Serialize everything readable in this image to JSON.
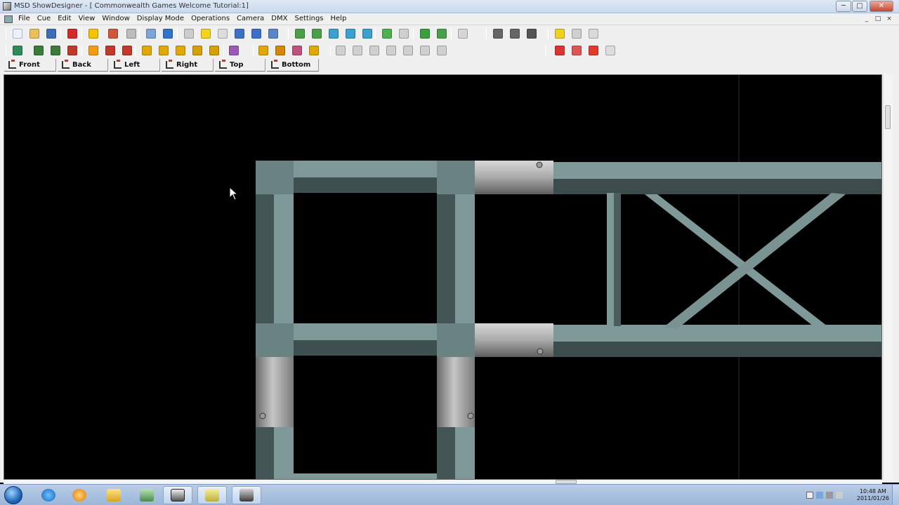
{
  "window": {
    "title": "MSD ShowDesigner - [ Commonwealth Games Welcome Tutorial:1]",
    "controls": {
      "minimize": "─",
      "maximize": "□",
      "close": "✕"
    },
    "mdi_controls": {
      "minimize": "_",
      "restore": "□",
      "close": "×"
    }
  },
  "menubar": {
    "items": [
      "File",
      "Cue",
      "Edit",
      "View",
      "Window",
      "Display Mode",
      "Operations",
      "Camera",
      "DMX",
      "Settings",
      "Help"
    ]
  },
  "toolbar": {
    "row1_icons": [
      "new-file",
      "open-folder",
      "save",
      "delete",
      "select-pointer",
      "undo",
      "redo",
      "print",
      "info",
      "cut",
      "light-bulb",
      "search",
      "fixture-f",
      "fixture-p",
      "fixture-key",
      "zoom-in",
      "zoom-check",
      "rotate",
      "move",
      "pan",
      "refresh",
      "refresh-disabled",
      "eye",
      "add-view",
      "disabled-box",
      "truss-a",
      "truss-b",
      "truss-c",
      "figure-light",
      "figure-gray",
      "figure-outline"
    ],
    "row2_icons": [
      "move-tool",
      "orbit",
      "orbit-b",
      "grid-tool",
      "snap",
      "arrow-h",
      "arrow-v",
      "fixture-y1",
      "fixture-y2",
      "fixture-y3",
      "link",
      "curve",
      "text-tool",
      "box-a",
      "box-b",
      "box-c",
      "box-d",
      "disabled-1",
      "disabled-2",
      "disabled-3",
      "disabled-4",
      "disabled-5",
      "disabled-6",
      "disabled-7",
      "render-wire",
      "render-solid",
      "render-red",
      "render-gray"
    ]
  },
  "views": {
    "buttons": [
      "Front",
      "Back",
      "Left",
      "Right",
      "Top",
      "Bottom"
    ]
  },
  "colors": {
    "truss_light": "#7f9898",
    "truss_mid": "#6a8282",
    "truss_dark": "#3e4f4f",
    "coupler_light": "#c9c9c9",
    "coupler_dark": "#6e6e6e",
    "background": "#000000"
  },
  "taskbar": {
    "apps": [
      "internet-explorer",
      "media-player",
      "file-explorer",
      "network-app",
      "show-designer",
      "notes-app",
      "tools-app"
    ],
    "clock_time": "10:48 AM",
    "clock_date": "2011/01/26"
  }
}
